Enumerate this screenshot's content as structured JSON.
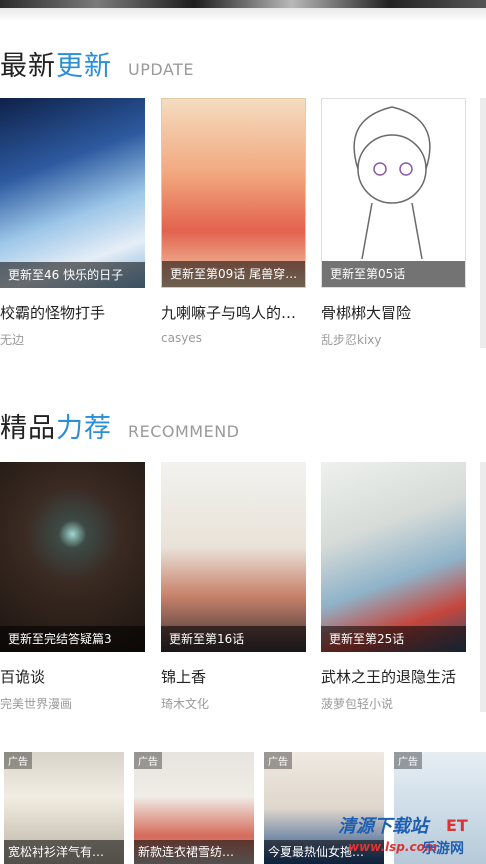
{
  "sections": {
    "update": {
      "title_part1": "最新",
      "title_part2": "更新",
      "subtitle": "UPDATE",
      "comics": [
        {
          "progress": "更新至46 快乐的日子",
          "title": "校霸的怪物打手",
          "author": "无边"
        },
        {
          "progress": "更新至第09话 尾兽穿…",
          "title": "九喇嘛子与鸣人的…",
          "author": "casyes"
        },
        {
          "progress": "更新至第05话",
          "title": "骨梆梆大冒险",
          "author": "乱步忍kixy"
        }
      ]
    },
    "recommend": {
      "title_part1": "精品",
      "title_part2": "力荐",
      "subtitle": "RECOMMEND",
      "comics": [
        {
          "progress": "更新至完结答疑篇3",
          "title": "百诡谈",
          "author": "完美世界漫画"
        },
        {
          "progress": "更新至第16话",
          "title": "锦上香",
          "author": "琦木文化"
        },
        {
          "progress": "更新至第25话",
          "title": "武林之王的退隐生活",
          "author": "菠萝包轻小说"
        }
      ]
    }
  },
  "ads": [
    {
      "tag": "广告",
      "caption": "宽松衬衫洋气有…"
    },
    {
      "tag": "广告",
      "caption": "新款连衣裙雪纺…"
    },
    {
      "tag": "广告",
      "caption": "今夏最热仙女拖…"
    },
    {
      "tag": "广告",
      "caption": ""
    }
  ],
  "watermark": {
    "line1": "清源下载站",
    "line2": "ET",
    "line3": "www.lsp.com",
    "line4": "乐游网"
  },
  "colors": {
    "accent": "#2a8fd6",
    "title_text": "#222222",
    "sub_text": "#9a9a9a",
    "overlay": "rgba(0,0,0,0.55)"
  }
}
